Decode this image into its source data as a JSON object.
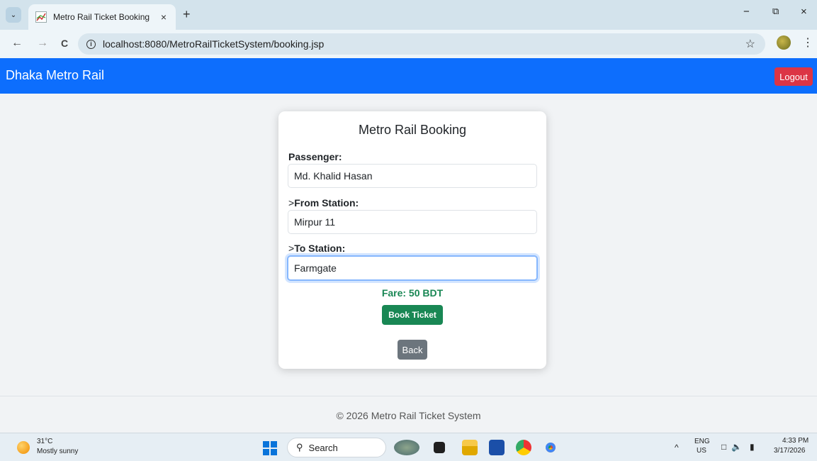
{
  "browser": {
    "tab_title": "Metro Rail Ticket Booking",
    "tab_close": "×",
    "new_tab": "+",
    "url": "localhost:8080/MetroRailTicketSystem/booking.jsp",
    "minimize": "−",
    "restore": "⧉",
    "close": "×",
    "back": "←",
    "forward": "→",
    "reload": "C",
    "bookmark": "☆",
    "menu": "⋮",
    "tab_menu": "⌄"
  },
  "navbar": {
    "brand": "Dhaka Metro Rail",
    "logout_label": "Logout",
    "color": "#0d6efd"
  },
  "form": {
    "title": "Metro Rail Booking",
    "passenger_label": "Passenger:",
    "passenger_value": "Md. Khalid Hasan",
    "from_prefix": ">",
    "from_label": "From Station:",
    "from_value": "Mirpur 11",
    "to_prefix": ">",
    "to_label": "To Station:",
    "to_value": "Farmgate",
    "fare": "Fare: 50 BDT",
    "book_label": "Book Ticket",
    "back_label": "Back"
  },
  "footer": {
    "text": "© 2026 Metro Rail Ticket System"
  },
  "taskbar": {
    "temperature": "31°C",
    "weather": "Mostly sunny",
    "search_label": "Search",
    "search_icon": "search-icon",
    "chevron": "^",
    "lang_top": "ENG",
    "lang_bottom": "US",
    "time": "4:33 PM",
    "date": "3/17/2026"
  }
}
